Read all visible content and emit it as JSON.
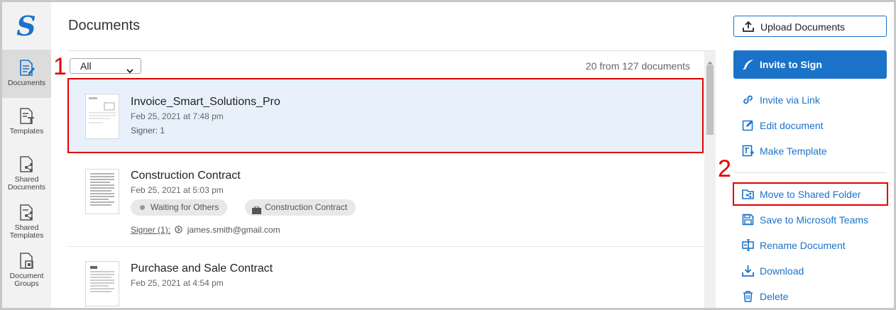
{
  "sidebar": {
    "logo": "S",
    "items": [
      {
        "label": "Documents"
      },
      {
        "label": "Templates"
      },
      {
        "label": "Shared Documents"
      },
      {
        "label": "Shared Templates"
      },
      {
        "label": "Document Groups"
      }
    ]
  },
  "header": {
    "title": "Documents"
  },
  "list": {
    "filter_value": "All",
    "count_text": "20 from 127 documents",
    "documents": [
      {
        "name": "Invoice_Smart_Solutions_Pro",
        "date": "Feb 25, 2021 at 7:48 pm",
        "signer": "Signer: 1"
      },
      {
        "name": "Construction Contract",
        "date": "Feb 25, 2021 at 5:03 pm",
        "status": "Waiting for Others",
        "folder": "Construction Contract",
        "signer_label": "Signer (1):",
        "signer_email": "james.smith@gmail.com"
      },
      {
        "name": "Purchase and Sale Contract",
        "date": "Feb 25, 2021 at 4:54 pm"
      }
    ]
  },
  "actions": {
    "upload": "Upload Documents",
    "invite": "Invite to Sign",
    "items": [
      {
        "label": "Invite via Link",
        "icon": "link-icon"
      },
      {
        "label": "Edit document",
        "icon": "edit-icon"
      },
      {
        "label": "Make Template",
        "icon": "template-icon"
      },
      {
        "label": "Move to Shared Folder",
        "icon": "shared-folder-icon"
      },
      {
        "label": "Save to Microsoft Teams",
        "icon": "save-icon"
      },
      {
        "label": "Rename Document",
        "icon": "rename-icon"
      },
      {
        "label": "Download",
        "icon": "download-icon"
      },
      {
        "label": "Delete",
        "icon": "trash-icon"
      }
    ]
  },
  "annotations": {
    "one": "1",
    "two": "2"
  },
  "colors": {
    "accent": "#1a73c9",
    "annotation": "#e00000",
    "selected_row": "#e8f1fb"
  }
}
